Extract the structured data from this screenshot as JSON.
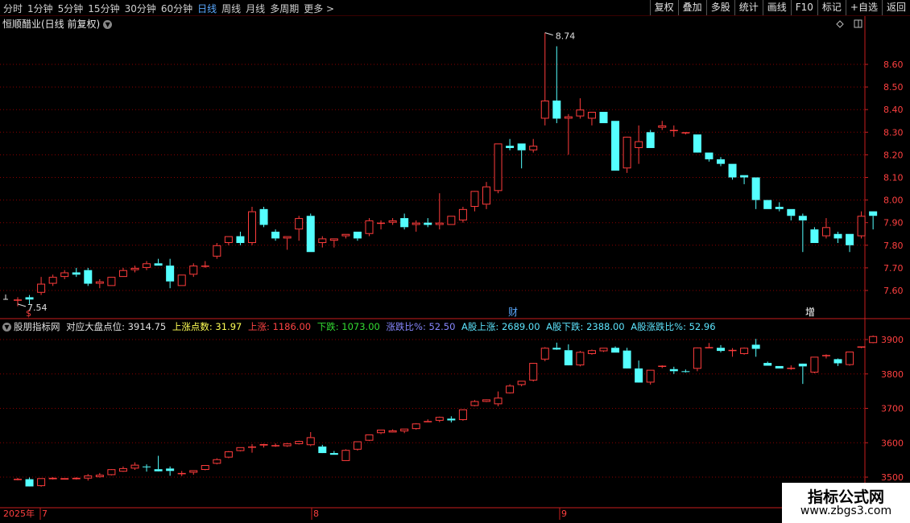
{
  "toolbar": {
    "periods": [
      "分时",
      "1分钟",
      "5分钟",
      "15分钟",
      "30分钟",
      "60分钟",
      "日线",
      "周线",
      "月线",
      "多周期",
      "更多 >"
    ],
    "active_period": "日线",
    "right_buttons": [
      "复权",
      "叠加",
      "多股",
      "统计",
      "画线",
      "F10",
      "标记",
      "+自选",
      "返回"
    ]
  },
  "main": {
    "title": "恒顺醋业(日线 前复权)",
    "high_label": "8.74",
    "low_label": "7.54",
    "marker_cai": "财",
    "marker_zeng": "增",
    "marker_left": "$"
  },
  "sub": {
    "indicator": "股朋指标网",
    "fields": [
      {
        "label": "对应大盘点位:",
        "value": "3914.75",
        "color": "#e0e0e0"
      },
      {
        "label": "上涨点数:",
        "value": "31.97",
        "color": "#ffff55"
      },
      {
        "label": "上涨:",
        "value": "1186.00",
        "color": "#ff4444"
      },
      {
        "label": "下跌:",
        "value": "1073.00",
        "color": "#33dd33"
      },
      {
        "label": "涨跌比%:",
        "value": "52.50",
        "color": "#8888ff"
      },
      {
        "label": "A股上涨:",
        "value": "2689.00",
        "color": "#5ee6ff"
      },
      {
        "label": "A股下跌:",
        "value": "2388.00",
        "color": "#5ee6ff"
      },
      {
        "label": "A股涨跌比%:",
        "value": "52.96",
        "color": "#5ee6ff"
      }
    ]
  },
  "time_axis": {
    "year_label": "2025年",
    "month_labels": [
      "7",
      "8",
      "9"
    ]
  },
  "watermark": {
    "line1": "指标公式网",
    "line2": "www.zbgs3.com"
  },
  "colors": {
    "up": "#ff3c3c",
    "down": "#54ffff",
    "grid": "#8b0000",
    "axis": "#c81e1e",
    "text": "#ff4040"
  },
  "chart_data": [
    {
      "type": "candlestick",
      "title": "恒顺醋业(日线 前复权)",
      "ylim": [
        7.5,
        8.8
      ],
      "y_ticks": [
        7.6,
        7.7,
        7.8,
        7.9,
        8.0,
        8.1,
        8.2,
        8.3,
        8.4,
        8.5,
        8.6
      ],
      "candles": [
        [
          7.56,
          7.57,
          7.53,
          7.56
        ],
        [
          7.57,
          7.58,
          7.54,
          7.56
        ],
        [
          7.59,
          7.66,
          7.58,
          7.63
        ],
        [
          7.63,
          7.67,
          7.62,
          7.66
        ],
        [
          7.66,
          7.69,
          7.65,
          7.68
        ],
        [
          7.68,
          7.7,
          7.66,
          7.67
        ],
        [
          7.69,
          7.7,
          7.62,
          7.63
        ],
        [
          7.63,
          7.65,
          7.61,
          7.64
        ],
        [
          7.62,
          7.66,
          7.62,
          7.66
        ],
        [
          7.66,
          7.7,
          7.66,
          7.69
        ],
        [
          7.69,
          7.71,
          7.68,
          7.7
        ],
        [
          7.7,
          7.73,
          7.69,
          7.72
        ],
        [
          7.72,
          7.74,
          7.71,
          7.71
        ],
        [
          7.71,
          7.74,
          7.61,
          7.64
        ],
        [
          7.62,
          7.67,
          7.62,
          7.67
        ],
        [
          7.67,
          7.72,
          7.66,
          7.71
        ],
        [
          7.71,
          7.73,
          7.7,
          7.71
        ],
        [
          7.75,
          7.81,
          7.74,
          7.8
        ],
        [
          7.81,
          7.84,
          7.8,
          7.84
        ],
        [
          7.84,
          7.86,
          7.8,
          7.81
        ],
        [
          7.81,
          7.97,
          7.8,
          7.95
        ],
        [
          7.96,
          7.97,
          7.88,
          7.89
        ],
        [
          7.86,
          7.87,
          7.82,
          7.83
        ],
        [
          7.83,
          7.84,
          7.78,
          7.84
        ],
        [
          7.87,
          7.93,
          7.82,
          7.92
        ],
        [
          7.93,
          7.94,
          7.77,
          7.77
        ],
        [
          7.81,
          7.84,
          7.79,
          7.83
        ],
        [
          7.82,
          7.83,
          7.79,
          7.83
        ],
        [
          7.84,
          7.85,
          7.83,
          7.85
        ],
        [
          7.86,
          7.86,
          7.82,
          7.83
        ],
        [
          7.85,
          7.92,
          7.84,
          7.91
        ],
        [
          7.9,
          7.91,
          7.87,
          7.9
        ],
        [
          7.9,
          7.92,
          7.89,
          7.91
        ],
        [
          7.92,
          7.94,
          7.87,
          7.88
        ],
        [
          7.89,
          7.91,
          7.86,
          7.9
        ],
        [
          7.9,
          7.92,
          7.88,
          7.89
        ],
        [
          7.89,
          8.03,
          7.87,
          7.9
        ],
        [
          7.89,
          7.93,
          7.89,
          7.93
        ],
        [
          7.91,
          7.97,
          7.9,
          7.96
        ],
        [
          7.97,
          8.03,
          7.95,
          8.04
        ],
        [
          7.98,
          8.08,
          7.96,
          8.06
        ],
        [
          8.04,
          8.25,
          8.03,
          8.25
        ],
        [
          8.24,
          8.27,
          8.22,
          8.23
        ],
        [
          8.25,
          8.25,
          8.14,
          8.22
        ],
        [
          8.22,
          8.27,
          8.21,
          8.24
        ],
        [
          8.36,
          8.74,
          8.33,
          8.44
        ],
        [
          8.44,
          8.68,
          8.34,
          8.36
        ],
        [
          8.36,
          8.38,
          8.2,
          8.37
        ],
        [
          8.37,
          8.45,
          8.36,
          8.4
        ],
        [
          8.36,
          8.39,
          8.33,
          8.39
        ],
        [
          8.39,
          8.39,
          8.34,
          8.34
        ],
        [
          8.35,
          8.35,
          8.13,
          8.13
        ],
        [
          8.14,
          8.24,
          8.12,
          8.28
        ],
        [
          8.23,
          8.33,
          8.16,
          8.26
        ],
        [
          8.3,
          8.31,
          8.23,
          8.23
        ],
        [
          8.32,
          8.35,
          8.31,
          8.33
        ],
        [
          8.31,
          8.33,
          8.28,
          8.31
        ],
        [
          8.3,
          8.3,
          8.29,
          8.3
        ],
        [
          8.29,
          8.29,
          8.26,
          8.21
        ],
        [
          8.21,
          8.21,
          8.17,
          8.18
        ],
        [
          8.18,
          8.19,
          8.15,
          8.16
        ],
        [
          8.16,
          8.16,
          8.09,
          8.1
        ],
        [
          8.11,
          8.11,
          8.07,
          8.1
        ],
        [
          8.1,
          8.1,
          7.96,
          8.0
        ],
        [
          8.0,
          8.0,
          7.96,
          7.96
        ],
        [
          7.97,
          7.99,
          7.95,
          7.96
        ],
        [
          7.96,
          7.96,
          7.91,
          7.93
        ],
        [
          7.93,
          7.94,
          7.77,
          7.91
        ],
        [
          7.87,
          7.88,
          7.81,
          7.81
        ],
        [
          7.84,
          7.92,
          7.83,
          7.88
        ],
        [
          7.85,
          7.86,
          7.81,
          7.83
        ],
        [
          7.85,
          7.85,
          7.77,
          7.8
        ],
        [
          7.84,
          7.95,
          7.83,
          7.93
        ],
        [
          7.95,
          7.95,
          7.87,
          7.93
        ]
      ]
    },
    {
      "type": "candlestick",
      "title": "股朋指标网",
      "ylim": [
        3480,
        3925
      ],
      "y_ticks": [
        3500,
        3600,
        3700,
        3800,
        3900
      ],
      "candles": [
        [
          3494,
          3498,
          3491,
          3495
        ],
        [
          3494,
          3499,
          3475,
          3473
        ],
        [
          3474,
          3497,
          3472,
          3497
        ],
        [
          3494,
          3500,
          3493,
          3498
        ],
        [
          3493,
          3497,
          3493,
          3497
        ],
        [
          3494,
          3500,
          3493,
          3498
        ],
        [
          3496,
          3509,
          3490,
          3505
        ],
        [
          3500,
          3512,
          3499,
          3507
        ],
        [
          3506,
          3520,
          3505,
          3523
        ],
        [
          3516,
          3531,
          3515,
          3526
        ],
        [
          3525,
          3543,
          3521,
          3536
        ],
        [
          3531,
          3537,
          3516,
          3530
        ],
        [
          3523,
          3562,
          3518,
          3517
        ],
        [
          3525,
          3531,
          3504,
          3518
        ],
        [
          3510,
          3518,
          3503,
          3512
        ],
        [
          3513,
          3520,
          3507,
          3520
        ],
        [
          3521,
          3535,
          3520,
          3535
        ],
        [
          3539,
          3555,
          3537,
          3552
        ],
        [
          3557,
          3576,
          3555,
          3575
        ],
        [
          3576,
          3587,
          3575,
          3587
        ],
        [
          3586,
          3596,
          3571,
          3589
        ],
        [
          3592,
          3597,
          3586,
          3596
        ],
        [
          3593,
          3598,
          3588,
          3593
        ],
        [
          3590,
          3599,
          3588,
          3598
        ],
        [
          3596,
          3606,
          3595,
          3605
        ],
        [
          3593,
          3631,
          3590,
          3616
        ],
        [
          3589,
          3594,
          3571,
          3570
        ],
        [
          3570,
          3576,
          3565,
          3565
        ],
        [
          3547,
          3581,
          3547,
          3579
        ],
        [
          3580,
          3604,
          3577,
          3604
        ],
        [
          3606,
          3624,
          3605,
          3624
        ],
        [
          3628,
          3638,
          3625,
          3638
        ],
        [
          3630,
          3639,
          3634,
          3636
        ],
        [
          3633,
          3641,
          3628,
          3641
        ],
        [
          3640,
          3657,
          3638,
          3656
        ],
        [
          3660,
          3668,
          3661,
          3663
        ],
        [
          3664,
          3676,
          3660,
          3675
        ],
        [
          3670,
          3677,
          3659,
          3665
        ],
        [
          3666,
          3696,
          3664,
          3697
        ],
        [
          3707,
          3724,
          3706,
          3721
        ],
        [
          3719,
          3725,
          3718,
          3726
        ],
        [
          3712,
          3749,
          3706,
          3731
        ],
        [
          3744,
          3770,
          3743,
          3766
        ],
        [
          3768,
          3780,
          3764,
          3780
        ],
        [
          3781,
          3830,
          3778,
          3832
        ],
        [
          3842,
          3878,
          3837,
          3876
        ],
        [
          3876,
          3891,
          3870,
          3871
        ],
        [
          3869,
          3886,
          3838,
          3825
        ],
        [
          3825,
          3867,
          3822,
          3864
        ],
        [
          3858,
          3871,
          3856,
          3869
        ],
        [
          3866,
          3876,
          3864,
          3876
        ],
        [
          3876,
          3880,
          3862,
          3862
        ],
        [
          3868,
          3876,
          3836,
          3816
        ],
        [
          3816,
          3839,
          3799,
          3775
        ],
        [
          3775,
          3812,
          3769,
          3812
        ],
        [
          3823,
          3825,
          3817,
          3824
        ],
        [
          3814,
          3821,
          3800,
          3808
        ],
        [
          3808,
          3813,
          3804,
          3806
        ],
        [
          3815,
          3875,
          3808,
          3877
        ],
        [
          3878,
          3890,
          3876,
          3878
        ],
        [
          3876,
          3884,
          3863,
          3867
        ],
        [
          3870,
          3875,
          3850,
          3870
        ],
        [
          3858,
          3877,
          3856,
          3876
        ],
        [
          3885,
          3902,
          3850,
          3873
        ],
        [
          3832,
          3836,
          3826,
          3824
        ],
        [
          3823,
          3823,
          3816,
          3816
        ],
        [
          3818,
          3825,
          3812,
          3818
        ],
        [
          3830,
          3829,
          3771,
          3822
        ],
        [
          3804,
          3850,
          3802,
          3850
        ],
        [
          3855,
          3857,
          3845,
          3855
        ],
        [
          3843,
          3845,
          3823,
          3831
        ],
        [
          3826,
          3863,
          3824,
          3865
        ],
        [
          3879,
          3880,
          3875,
          3880
        ],
        [
          3890,
          3912,
          3889,
          3910
        ]
      ]
    }
  ]
}
